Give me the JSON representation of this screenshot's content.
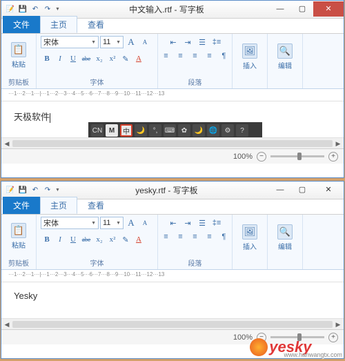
{
  "window1": {
    "title": "中文输入.rtf - 写字板",
    "qat": {
      "save_icon": "💾",
      "undo_icon": "↶",
      "redo_icon": "↷"
    },
    "winbtns": {
      "min": "—",
      "max": "▢",
      "close": "✕"
    },
    "tabs": {
      "file": "文件",
      "home": "主页",
      "view": "查看"
    },
    "ribbon": {
      "clipboard": {
        "paste": "粘贴",
        "paste_icon": "📋",
        "group": "剪贴板"
      },
      "font": {
        "name": "宋体",
        "size": "11",
        "grow": "A",
        "shrink": "A",
        "bold": "B",
        "italic": "I",
        "underline": "U",
        "strike": "abe",
        "sub": "x₂",
        "sup": "x²",
        "highlight": "✎",
        "color": "A",
        "group": "字体"
      },
      "paragraph": {
        "group": "段落"
      },
      "insert": {
        "label": "插入",
        "icon": "🖼"
      },
      "edit": {
        "label": "编辑",
        "icon": "🔍"
      }
    },
    "ruler": "···1···2···1···|···1···2···3···4···5···6···7···8···9···10···11···12···13",
    "document_text": "天极软件",
    "ime": {
      "cn": "CN",
      "m": "M",
      "zh": "中"
    },
    "status": {
      "zoom": "100%",
      "minus": "−",
      "plus": "+"
    }
  },
  "window2": {
    "title": "yesky.rtf - 写字板",
    "qat": {
      "save_icon": "💾",
      "undo_icon": "↶",
      "redo_icon": "↷"
    },
    "winbtns": {
      "min": "—",
      "max": "▢",
      "close": "✕"
    },
    "tabs": {
      "file": "文件",
      "home": "主页",
      "view": "查看"
    },
    "ribbon": {
      "clipboard": {
        "paste": "粘贴",
        "paste_icon": "📋",
        "group": "剪贴板"
      },
      "font": {
        "name": "宋体",
        "size": "11",
        "grow": "A",
        "shrink": "A",
        "bold": "B",
        "italic": "I",
        "underline": "U",
        "strike": "abe",
        "sub": "x₂",
        "sup": "x²",
        "highlight": "✎",
        "color": "A",
        "group": "字体"
      },
      "paragraph": {
        "group": "段落"
      },
      "insert": {
        "label": "插入",
        "icon": "🖼"
      },
      "edit": {
        "label": "编辑",
        "icon": "🔍"
      }
    },
    "ruler": "···1···2···1···|···1···2···3···4···5···6···7···8···9···10···11···12···13",
    "document_text": "Yesky",
    "status": {
      "zoom": "100%",
      "minus": "−",
      "plus": "+"
    }
  },
  "watermark": {
    "text": "yesky",
    "sub": "www.hanwangtx.com"
  }
}
